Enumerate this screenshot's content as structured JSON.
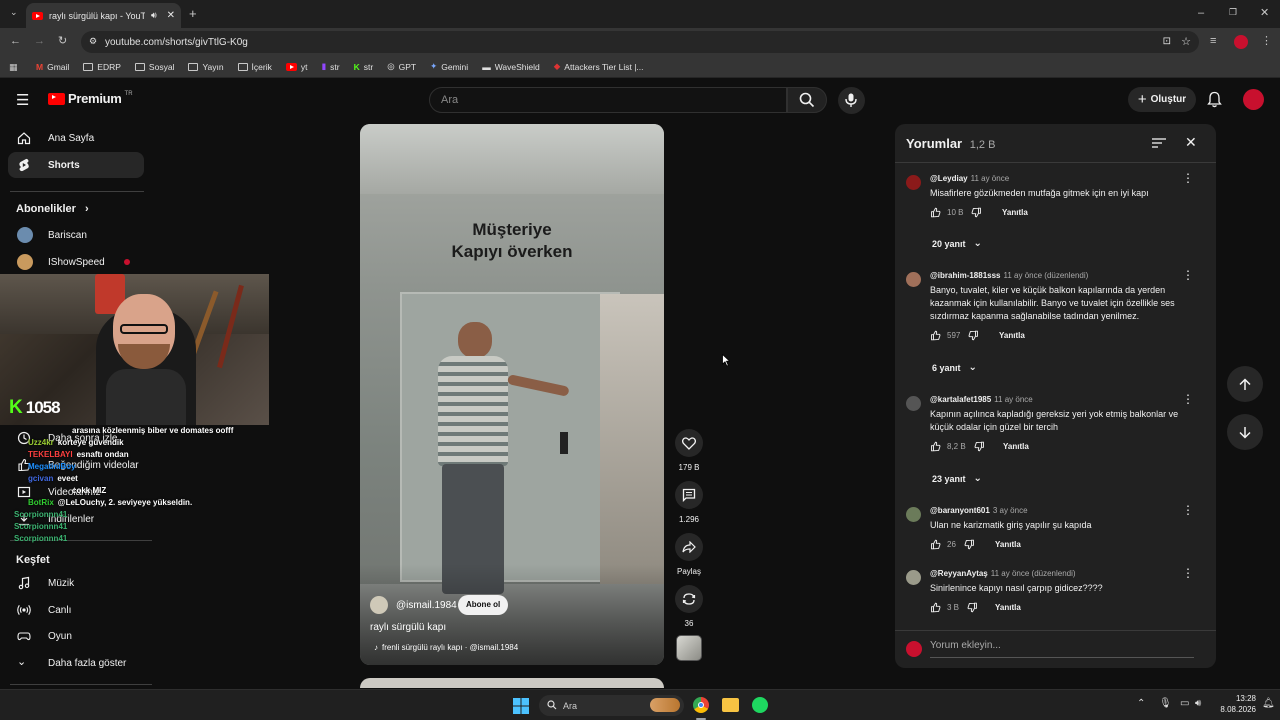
{
  "browser": {
    "tab_title": "raylı sürgülü kapı - YouTube",
    "url": "youtube.com/shorts/givTtlG-K0g",
    "bookmarks": [
      "Gmail",
      "EDRP",
      "Sosyal",
      "Yayın",
      "İçerik",
      "yt",
      "str",
      "str",
      "GPT",
      "Gemini",
      "WaveShield",
      "Attackers Tier List |..."
    ]
  },
  "header": {
    "logo": "Premium",
    "logo_badge": "TR",
    "search_placeholder": "Ara",
    "create_label": "Oluştur"
  },
  "sidebar": {
    "home": "Ana Sayfa",
    "shorts": "Shorts",
    "subs_heading": "Abonelikler",
    "subs": [
      "Bariscan",
      "IShowSpeed"
    ],
    "you_items": [
      "Daha sonra izle",
      "Beğendiğim videolar",
      "Videolarınız",
      "İndirilenler"
    ],
    "explore_heading": "Keşfet",
    "explore": [
      "Müzik",
      "Canlı",
      "Oyun"
    ],
    "more": "Daha fazla göster"
  },
  "overlay": {
    "viewer_count": "1058",
    "chat": [
      {
        "user": "",
        "msg": "arasına közleenmiş biber ve domates oofff",
        "color": "#ffffff"
      },
      {
        "user": "Uzz4kr",
        "msg": "korteye güvendik",
        "color": "#9acd32"
      },
      {
        "user": "TEKELBAYI",
        "msg": "esnaftı ondan",
        "color": "#ff4040"
      },
      {
        "user": "MegatiniBoy",
        "msg": "",
        "color": "#1e90ff"
      },
      {
        "user": "gcivan",
        "msg": "eveet",
        "color": "#4169e1"
      },
      {
        "user": "",
        "msg": "cokk MIZ",
        "color": "#ffffff"
      },
      {
        "user": "BotRix",
        "msg": "@LeLOuchy, 2. seviyeye yükseldin.",
        "color": "#32cd32"
      },
      {
        "user": "Scorpionnn41",
        "msg": "",
        "color": "#3cb371"
      },
      {
        "user": "Scorpionnn41",
        "msg": "",
        "color": "#3cb371"
      },
      {
        "user": "Scorpionnn41",
        "msg": "",
        "color": "#3cb371"
      }
    ]
  },
  "video": {
    "caption_line1": "Müşteriye",
    "caption_line2": "Kapıyı överken",
    "channel": "@ismail.1984",
    "subscribe": "Abone ol",
    "title": "raylı sürgülü kapı",
    "sound": "frenli sürgülü raylı kapı · @ismail.1984"
  },
  "actions": {
    "likes": "179 B",
    "comments": "1.296",
    "share": "Paylaş",
    "remix": "36"
  },
  "comments": {
    "title": "Yorumlar",
    "count": "1,2 B",
    "input_placeholder": "Yorum ekleyin...",
    "reply_label": "Yanıtla",
    "items": [
      {
        "user": "@Leydiay",
        "time": "11 ay önce",
        "text": "Misafirlere gözükmeden mutfağa gitmek için en iyi kapı",
        "likes": "10 B",
        "replies": "20 yanıt",
        "avatar": "#8b1a1a"
      },
      {
        "user": "@ibrahim-1881sss",
        "time": "11 ay önce (düzenlendi)",
        "text": "Banyo, tuvalet, kiler ve küçük balkon kapılarında da yerden kazanmak için kullanılabilir. Banyo ve tuvalet için özellikle ses sızdırmaz kapanma sağlanabilse tadından yenilmez.",
        "likes": "597",
        "replies": "6 yanıt",
        "avatar": "#a0705a"
      },
      {
        "user": "@kartalafet1985",
        "time": "11 ay önce",
        "text": "Kapının açılınca kapladığı gereksiz yeri yok etmiş balkonlar ve küçük odalar için güzel bir tercih",
        "likes": "8,2 B",
        "replies": "23 yanıt",
        "avatar": "#555555"
      },
      {
        "user": "@baranyont601",
        "time": "3 ay önce",
        "text": "Ulan ne karizmatik giriş yapılır şu kapıda",
        "likes": "26",
        "replies": "",
        "avatar": "#6b7b5a"
      },
      {
        "user": "@ReyyanAytaş",
        "time": "11 ay önce (düzenlendi)",
        "text": "Sinirlenince kapıyı nasıl çarpıp gidicez????",
        "likes": "3 B",
        "replies": "",
        "avatar": "#9a9a8a"
      }
    ]
  },
  "taskbar": {
    "search": "Ara",
    "time": "13:28",
    "date": "8.08.2026"
  },
  "colors": {
    "yt_red": "#ff0000",
    "bg": "#0f0f0f",
    "panel": "#212121"
  }
}
